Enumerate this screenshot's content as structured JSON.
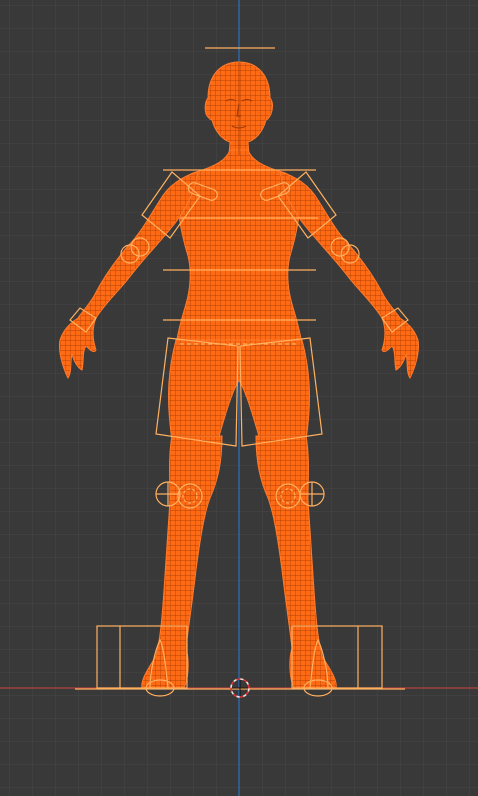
{
  "viewport": {
    "background": "#393939",
    "grid_color": "#4a4a4a",
    "x_axis_color": "#b5413d",
    "z_axis_color": "#2f6db3",
    "view": "front-orthographic",
    "shading": "wireframe"
  },
  "object": {
    "name": "human-figure",
    "fill_color": "#ff6a14",
    "wire_color": "#c04a08",
    "rig_color": "#ffb060",
    "selected": true
  },
  "cursor": {
    "name": "3d-cursor",
    "ring_color": "#e8e8e8",
    "accent_color": "#d33"
  }
}
